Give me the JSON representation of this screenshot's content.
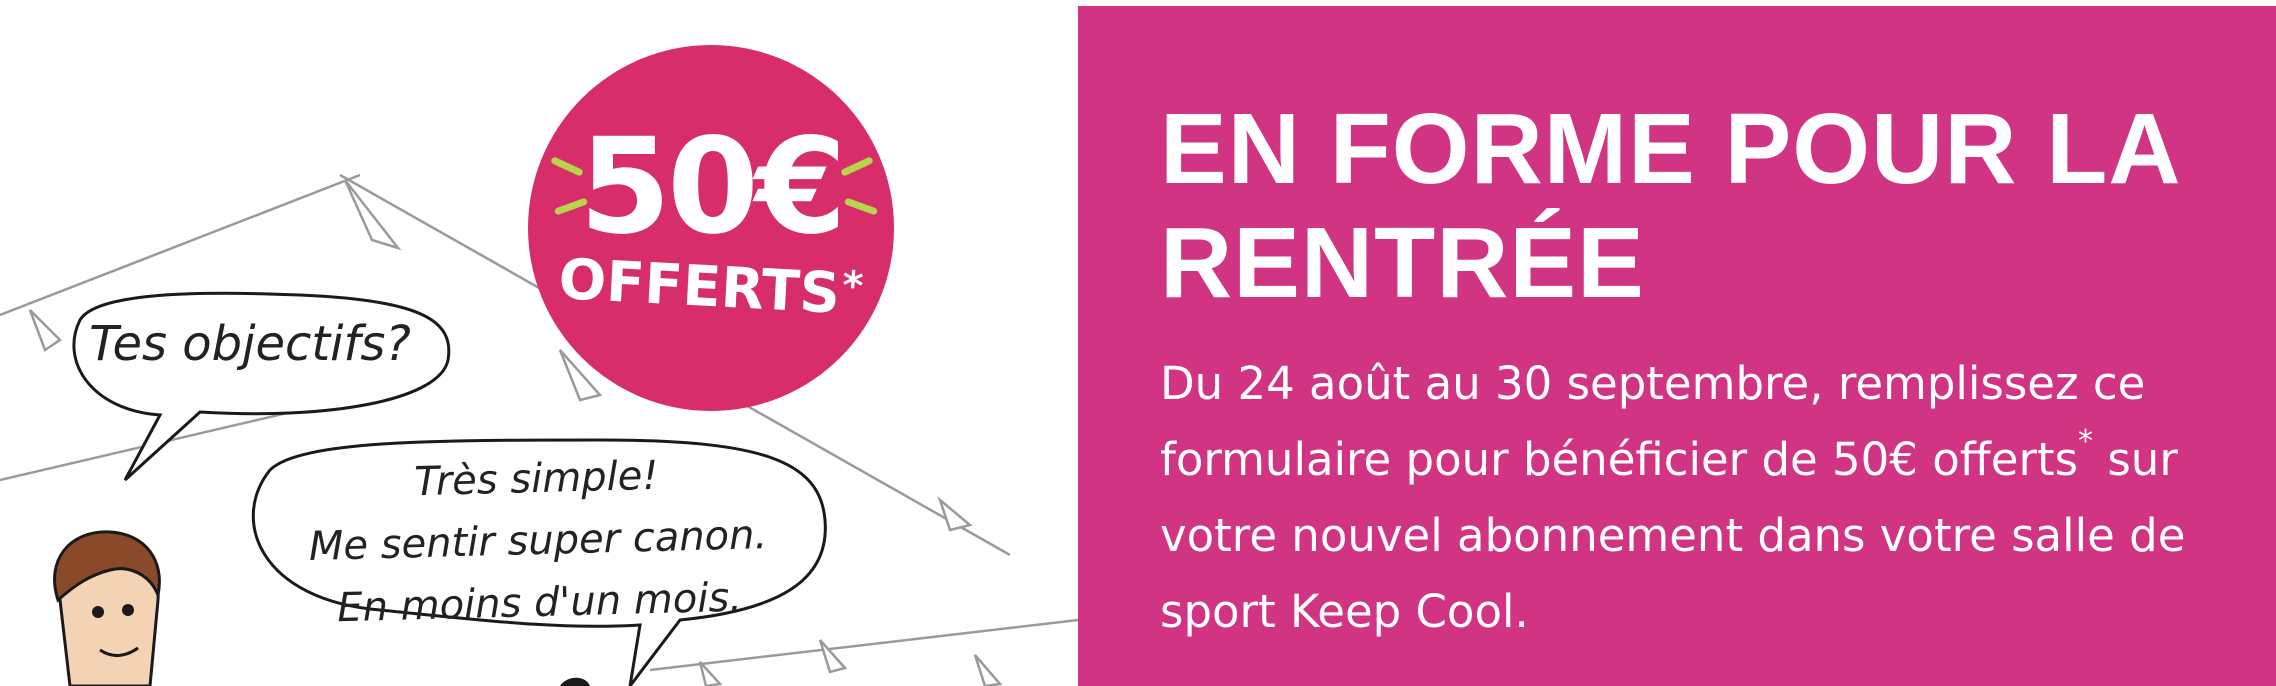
{
  "badge": {
    "amount": "50€",
    "label": "OFFERTS",
    "asterisk": "*"
  },
  "bubbles": {
    "question": "Tes objectifs?",
    "answer_line1": "Très simple!",
    "answer_line2": "Me sentir super canon.",
    "answer_line3": "En moins d'un mois."
  },
  "promo": {
    "title": "EN FORME POUR LA RENTRÉE",
    "body_before": "Du 24 août au 30 septembre, remplissez ce formulaire pour bénéficier de 50€ offerts",
    "body_asterisk": "*",
    "body_after": " sur votre nouvel abonnement dans votre salle de sport Keep Cool."
  },
  "colors": {
    "badge": "#d72d6a",
    "panel": "#d13482",
    "accent_sparks": "#b6d54b",
    "text_light": "#ffffff",
    "ink": "#222222"
  },
  "icons": {
    "character": "cartoon-man-avatar",
    "decorations": "bunting-flags"
  }
}
